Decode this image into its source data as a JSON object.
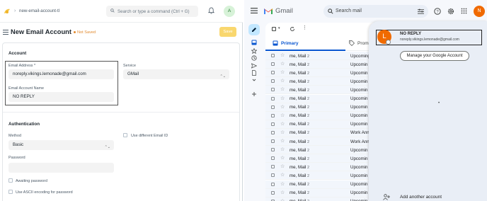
{
  "frappe": {
    "breadcrumb": "new-email-account-tl",
    "command_placeholder": "Search or type a command (Ctrl + G)",
    "user_initial": "A",
    "page_title": "New Email Account",
    "status": "Not Saved",
    "save_label": "Save",
    "account_section": "Account",
    "email_label": "Email Address *",
    "email_value": "noreply.vikings.lemonade@gmail.com",
    "service_label": "Service",
    "service_value": "GMail",
    "account_name_label": "Email Account Name",
    "account_name_value": "NO REPLY",
    "auth_section": "Authentication",
    "method_label": "Method",
    "method_value": "Basic",
    "use_diff_email_label": "Use different Email ID",
    "password_label": "Password",
    "awaiting_password_label": "Awaiting password",
    "ascii_label": "Use ASCII encoding for password",
    "colors": {
      "save": "#f9d76e",
      "not_saved": "#e28a2f"
    }
  },
  "gmail": {
    "brand": "Gmail",
    "search_placeholder": "Search mail",
    "avatar_initial": "N",
    "tabs": {
      "primary": "Primary",
      "promotions": "Promotion"
    },
    "rows": [
      {
        "sender": "me, Mail",
        "count": "2",
        "subject": "Upcoming"
      },
      {
        "sender": "me, Mail",
        "count": "2",
        "subject": "Upcomin"
      },
      {
        "sender": "me, Mail",
        "count": "2",
        "subject": "Upcomin"
      },
      {
        "sender": "me, Mail",
        "count": "2",
        "subject": "Upcomin"
      },
      {
        "sender": "me, Mail",
        "count": "2",
        "subject": "Upcomin"
      },
      {
        "sender": "me, Mail",
        "count": "2",
        "subject": "Upcomin"
      },
      {
        "sender": "me, Mail",
        "count": "2",
        "subject": "Upcomin"
      },
      {
        "sender": "me, Mail",
        "count": "2",
        "subject": "Upcomin"
      },
      {
        "sender": "me, Mail",
        "count": "2",
        "subject": "Upcomin"
      },
      {
        "sender": "me, Mail",
        "count": "2",
        "subject": "Work Ann"
      },
      {
        "sender": "me, Mail",
        "count": "2",
        "subject": "Work Ann"
      },
      {
        "sender": "me, Mail",
        "count": "2",
        "subject": "Upcomin"
      },
      {
        "sender": "me, Mail",
        "count": "2",
        "subject": "Upcomin"
      },
      {
        "sender": "me, Mail",
        "count": "2",
        "subject": "Upcomin"
      },
      {
        "sender": "me, Mail",
        "count": "2",
        "subject": "Upcomin"
      },
      {
        "sender": "me, Mail",
        "count": "2",
        "subject": "Upcomin"
      },
      {
        "sender": "me, Mail",
        "count": "2",
        "subject": "Upcomin"
      },
      {
        "sender": "me, Mail",
        "count": "2",
        "subject": "Upcomin"
      }
    ],
    "account_panel": {
      "initial": "L",
      "name": "NO REPLY",
      "email": "noreply.vikings.lemonade@gmail.com",
      "manage_label": "Manage your Google Account",
      "more": "•",
      "add_label": "Add another account"
    }
  }
}
